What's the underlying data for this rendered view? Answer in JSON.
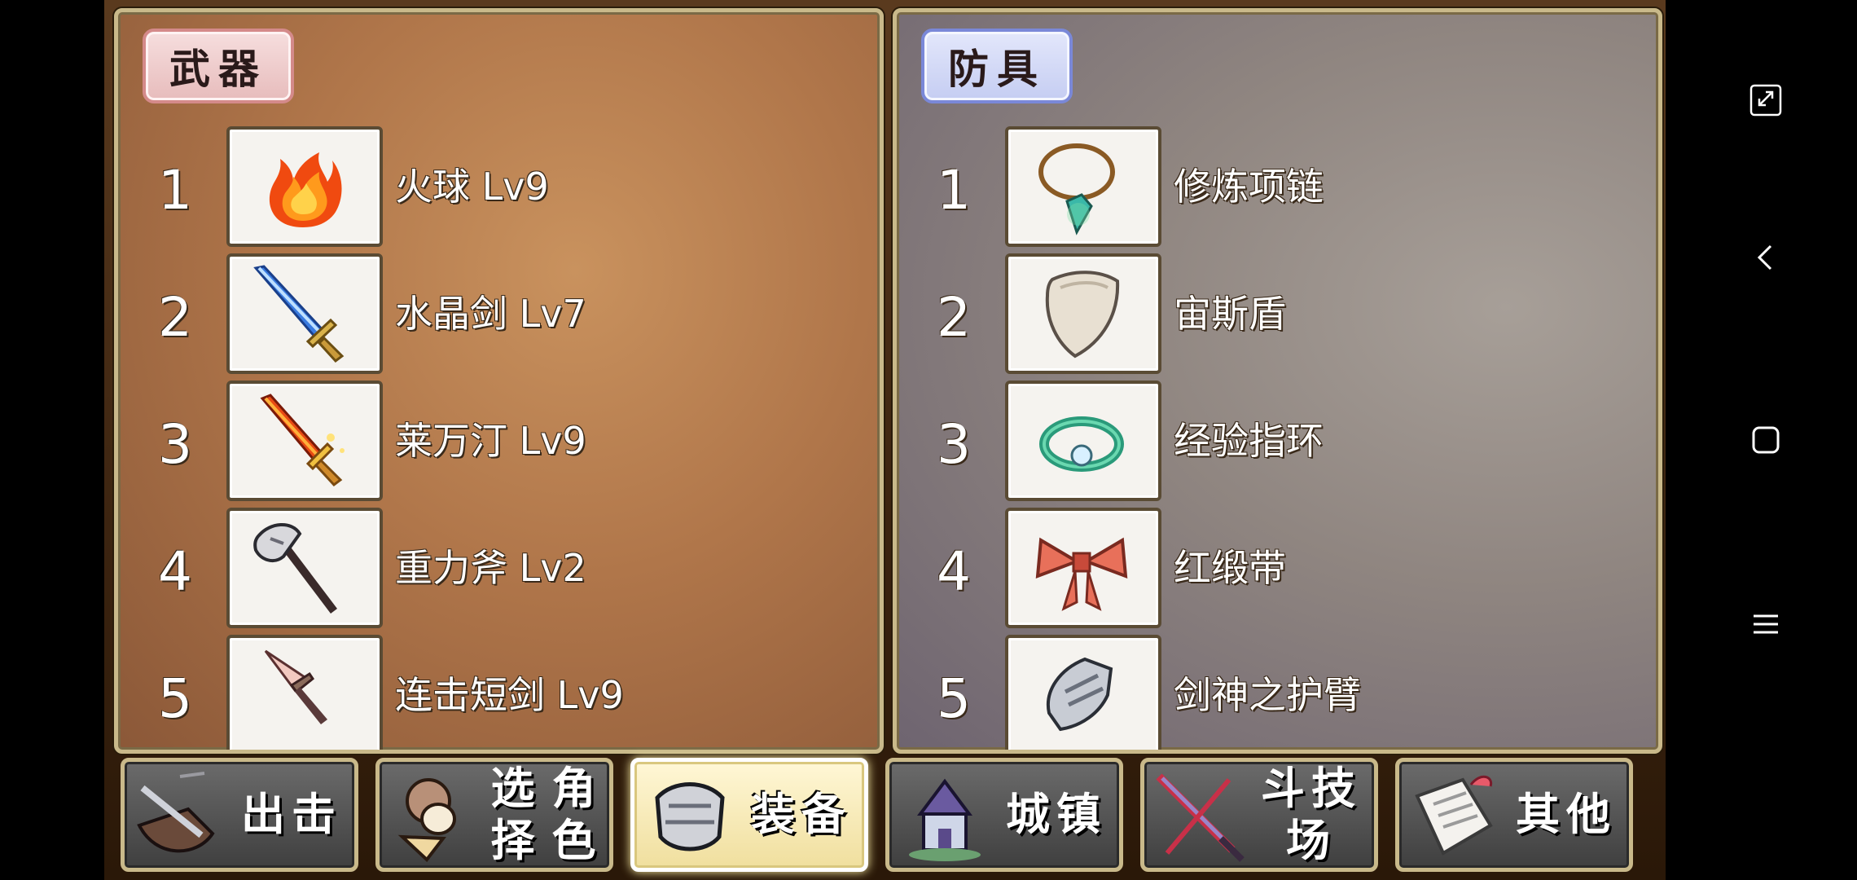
{
  "weapons": {
    "tag": "武器",
    "items": [
      {
        "num": "1",
        "name": "火球 Lv9",
        "icon": "fireball-icon"
      },
      {
        "num": "2",
        "name": "水晶剑 Lv7",
        "icon": "crystal-sword-icon"
      },
      {
        "num": "3",
        "name": "莱万汀 Lv9",
        "icon": "flame-sword-icon"
      },
      {
        "num": "4",
        "name": "重力斧 Lv2",
        "icon": "axe-icon"
      },
      {
        "num": "5",
        "name": "连击短剑 Lv9",
        "icon": "dagger-icon"
      }
    ]
  },
  "armor": {
    "tag": "防具",
    "items": [
      {
        "num": "1",
        "name": "修炼项链",
        "icon": "necklace-icon"
      },
      {
        "num": "2",
        "name": "宙斯盾",
        "icon": "shield-icon"
      },
      {
        "num": "3",
        "name": "经验指环",
        "icon": "ring-icon"
      },
      {
        "num": "4",
        "name": "红缎带",
        "icon": "ribbon-icon"
      },
      {
        "num": "5",
        "name": "剑神之护臂",
        "icon": "gauntlet-icon"
      }
    ]
  },
  "tabs": [
    {
      "label": "出击",
      "icon": "sortie-icon",
      "active": false
    },
    {
      "label": "选择角色",
      "line1": "选择",
      "line2": "角色",
      "icon": "character-icon",
      "active": false
    },
    {
      "label": "装备",
      "icon": "armor-icon",
      "active": true
    },
    {
      "label": "城镇",
      "icon": "town-icon",
      "active": false
    },
    {
      "label": "斗技场",
      "icon": "arena-icon",
      "active": false
    },
    {
      "label": "其他",
      "icon": "scroll-icon",
      "active": false
    }
  ],
  "system_nav": [
    "fullscreen-icon",
    "back-icon",
    "home-icon",
    "menu-icon"
  ]
}
